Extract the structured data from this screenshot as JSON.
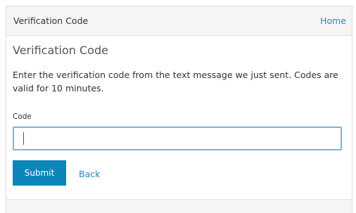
{
  "header": {
    "title": "Verification Code",
    "home_link": "Home"
  },
  "main": {
    "title": "Verification Code",
    "instructions": "Enter the verification code from the text message we just sent. Codes are valid for 10 minutes.",
    "code_field": {
      "label": "Code",
      "value": "",
      "placeholder": ""
    },
    "submit_label": "Submit",
    "back_label": "Back"
  },
  "colors": {
    "accent": "#0b86b8",
    "link": "#2a8ab8",
    "input_focus_border": "#76b6e0",
    "header_bg": "#f5f5f5"
  }
}
